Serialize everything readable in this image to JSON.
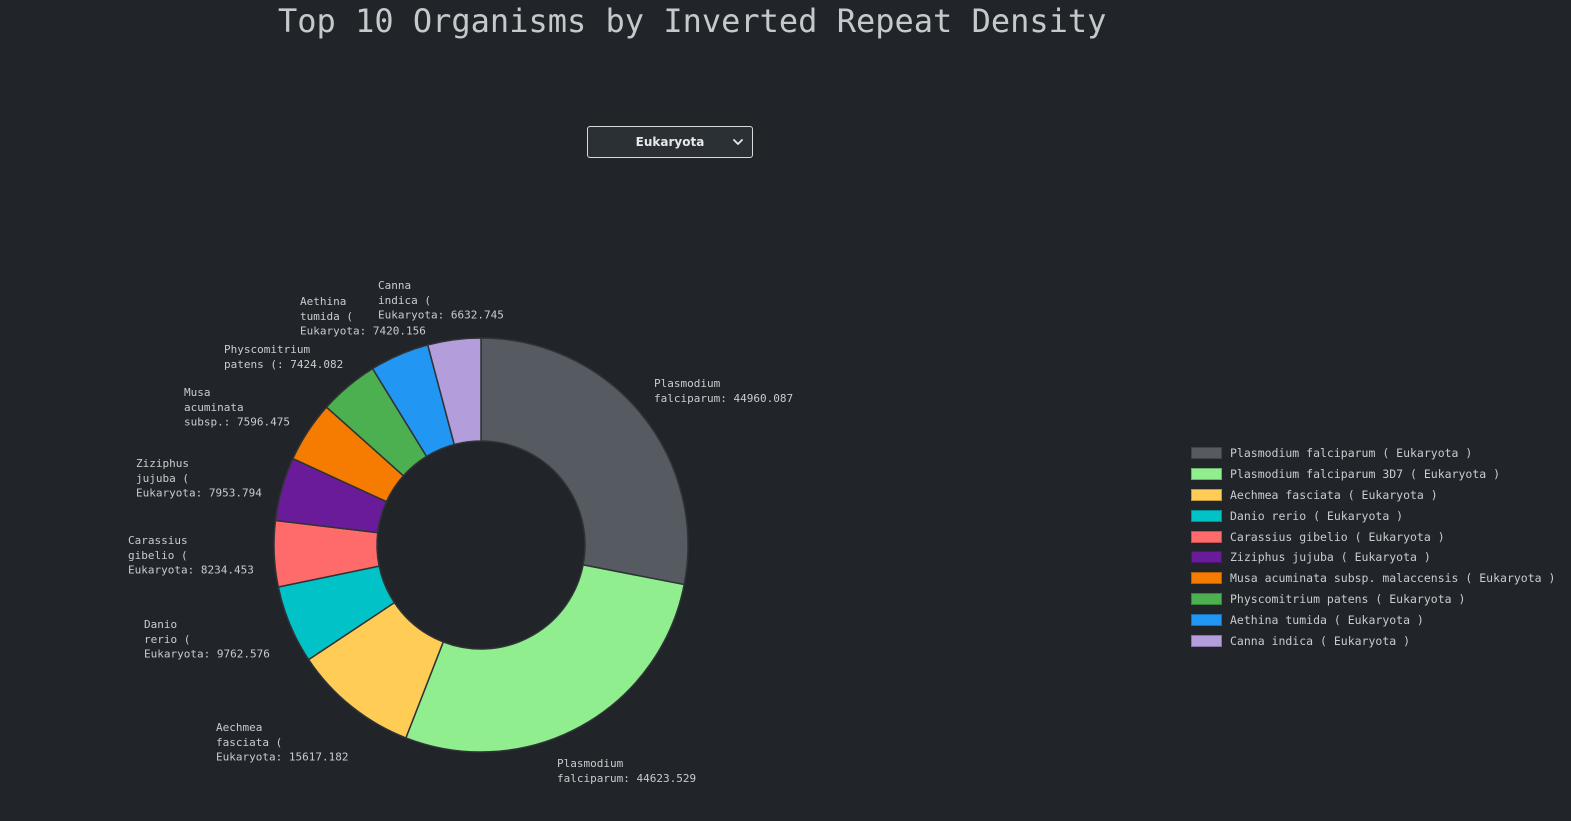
{
  "title": "Top 10 Organisms by Inverted Repeat Density",
  "dropdown": {
    "selected": "Eukaryota"
  },
  "colors": {
    "background": "#212529",
    "slice_border": "#2f3336"
  },
  "chart_data": {
    "type": "pie",
    "donut": true,
    "title": "Top 10 Organisms by Inverted Repeat Density",
    "legend_position": "right",
    "slices": [
      {
        "name": "Plasmodium falciparum ( Eukaryota )",
        "value": 44960.087,
        "label": [
          "Plasmodium",
          "falciparum: 44960.087"
        ],
        "color": "#555b61"
      },
      {
        "name": "Plasmodium falciparum 3D7 ( Eukaryota )",
        "value": 44623.529,
        "label": [
          "Plasmodium",
          "falciparum: 44623.529"
        ],
        "color": "#90ee8f"
      },
      {
        "name": "Aechmea fasciata ( Eukaryota )",
        "value": 15617.182,
        "label": [
          "Aechmea",
          "fasciata (",
          "Eukaryota: 15617.182"
        ],
        "color": "#ffcc55"
      },
      {
        "name": "Danio rerio ( Eukaryota )",
        "value": 9762.576,
        "label": [
          "Danio",
          "rerio (",
          "Eukaryota: 9762.576"
        ],
        "color": "#00c2c7"
      },
      {
        "name": "Carassius gibelio ( Eukaryota )",
        "value": 8234.453,
        "label": [
          "Carassius",
          "gibelio (",
          "Eukaryota: 8234.453"
        ],
        "color": "#ff6b6b"
      },
      {
        "name": "Ziziphus jujuba ( Eukaryota )",
        "value": 7953.794,
        "label": [
          "Ziziphus",
          "jujuba (",
          "Eukaryota: 7953.794"
        ],
        "color": "#6a1b9a"
      },
      {
        "name": "Musa acuminata subsp. malaccensis ( Eukaryota )",
        "value": 7596.475,
        "label": [
          "Musa",
          "acuminata",
          "subsp.: 7596.475"
        ],
        "color": "#f57c00"
      },
      {
        "name": "Physcomitrium patens ( Eukaryota )",
        "value": 7424.082,
        "label": [
          "Physcomitrium",
          "patens (: 7424.082"
        ],
        "color": "#4caf50"
      },
      {
        "name": "Aethina tumida ( Eukaryota )",
        "value": 7420.156,
        "label": [
          "Aethina",
          "tumida (",
          "Eukaryota: 7420.156"
        ],
        "color": "#2196f3"
      },
      {
        "name": "Canna indica ( Eukaryota )",
        "value": 6632.745,
        "label": [
          "Canna",
          "indica (",
          "Eukaryota: 6632.745"
        ],
        "color": "#b39ddb"
      }
    ]
  }
}
